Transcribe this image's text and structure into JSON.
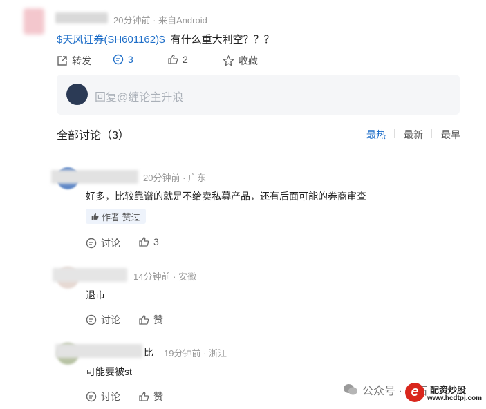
{
  "post": {
    "time_source": "20分钟前 · 来自Android",
    "stock_link": "$天风证券(SH601162)$",
    "question": "有什么重大利空？？？",
    "actions": {
      "repost_label": "转发",
      "comment_count": "3",
      "like_count": "2",
      "favorite_label": "收藏"
    }
  },
  "reply": {
    "placeholder": "回复@缠论主升浪"
  },
  "discussion": {
    "title": "全部讨论（3）",
    "sort_options": [
      "最热",
      "最新",
      "最早"
    ],
    "active_sort": "最热"
  },
  "comments": [
    {
      "name_suffix": "",
      "meta": "20分钟前 · 广东",
      "text": "好多，比较靠谱的就是不给卖私募产品，还有后面可能的券商审查",
      "badge": "作者 赞过",
      "discuss_label": "讨论",
      "like_label": "3"
    },
    {
      "name_suffix": "",
      "meta": "14分钟前 · 安徽",
      "text": "退市",
      "discuss_label": "讨论",
      "like_label": "赞"
    },
    {
      "name_suffix": "比",
      "meta": "19分钟前 · 浙江",
      "text": "可能要被st",
      "discuss_label": "讨论",
      "like_label": "赞"
    }
  ],
  "watermark": {
    "label": "公众号 · 金石",
    "logo_line1": "配资炒股",
    "logo_line2": "www.hcdtpj.com"
  },
  "colors": {
    "link": "#1e6ec8",
    "logo": "#d9261c"
  }
}
